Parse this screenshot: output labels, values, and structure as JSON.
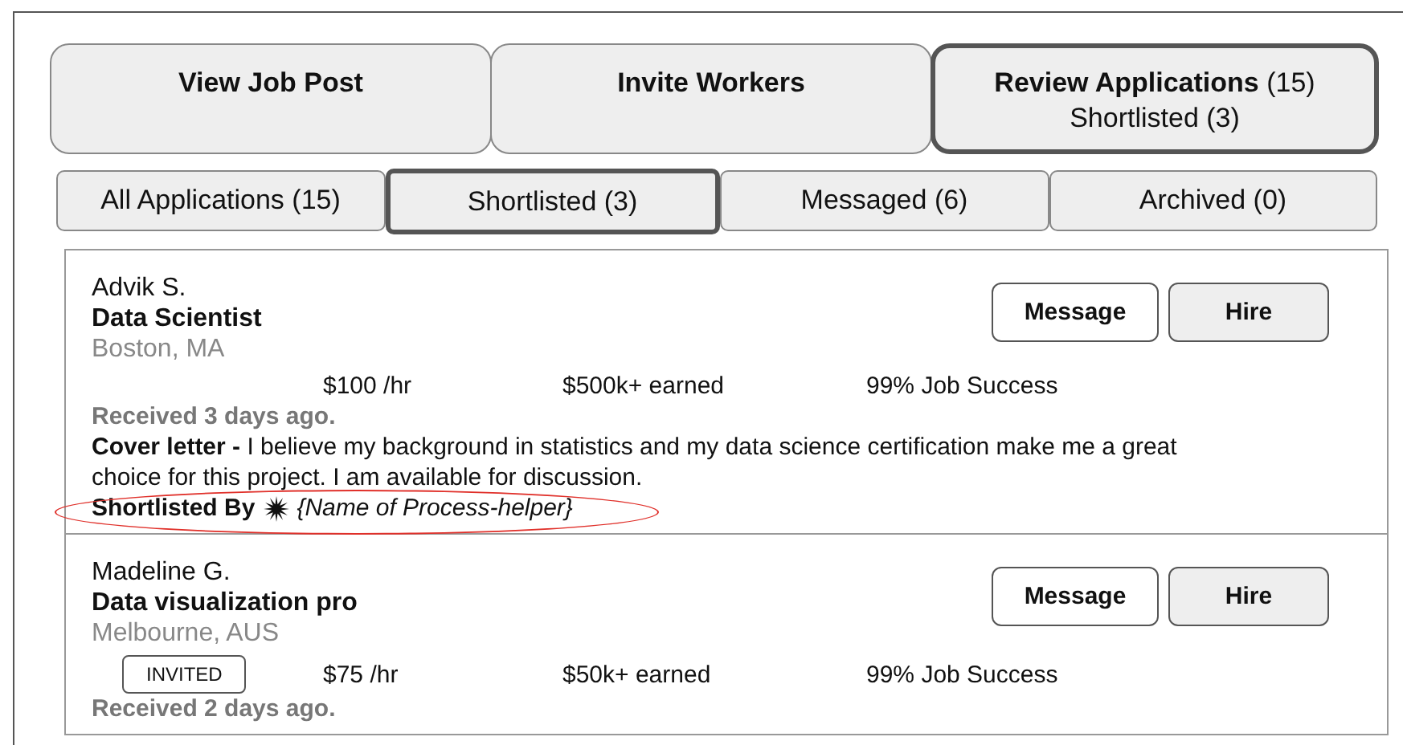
{
  "top_tabs": [
    {
      "title": "View Job Post",
      "selected": false
    },
    {
      "title": "Invite Workers",
      "selected": false
    },
    {
      "title": "Review Applications",
      "count": "(15)",
      "subtitle": "Shortlisted (3)",
      "selected": true
    }
  ],
  "sub_tabs": [
    {
      "label": "All Applications (15)",
      "selected": false
    },
    {
      "label": "Shortlisted (3)",
      "selected": true
    },
    {
      "label": "Messaged (6)",
      "selected": false
    },
    {
      "label": "Archived (0)",
      "selected": false
    }
  ],
  "applicants": [
    {
      "name": "Advik S.",
      "title": "Data Scientist",
      "location": "Boston, MA",
      "rate": "$100 /hr",
      "earned": "$500k+ earned",
      "success": "99% Job Success",
      "received": "Received 3 days ago.",
      "cover_letter": {
        "label": "Cover letter -",
        "text": "I believe my background in statistics and my data science certification make me a great choice for this project. I am available for discussion."
      },
      "shortlisted_by": {
        "label": "Shortlisted By",
        "value": "{Name of Process-helper}",
        "highlighted": true
      },
      "buttons": [
        "Message",
        "Hire"
      ]
    },
    {
      "name": "Madeline G.",
      "title": "Data visualization pro",
      "location": "Melbourne, AUS",
      "badge": "INVITED",
      "rate": "$75 /hr",
      "earned": "$50k+ earned",
      "success": "99% Job Success",
      "received": "Received 2 days ago.",
      "buttons": [
        "Message",
        "Hire"
      ]
    }
  ]
}
